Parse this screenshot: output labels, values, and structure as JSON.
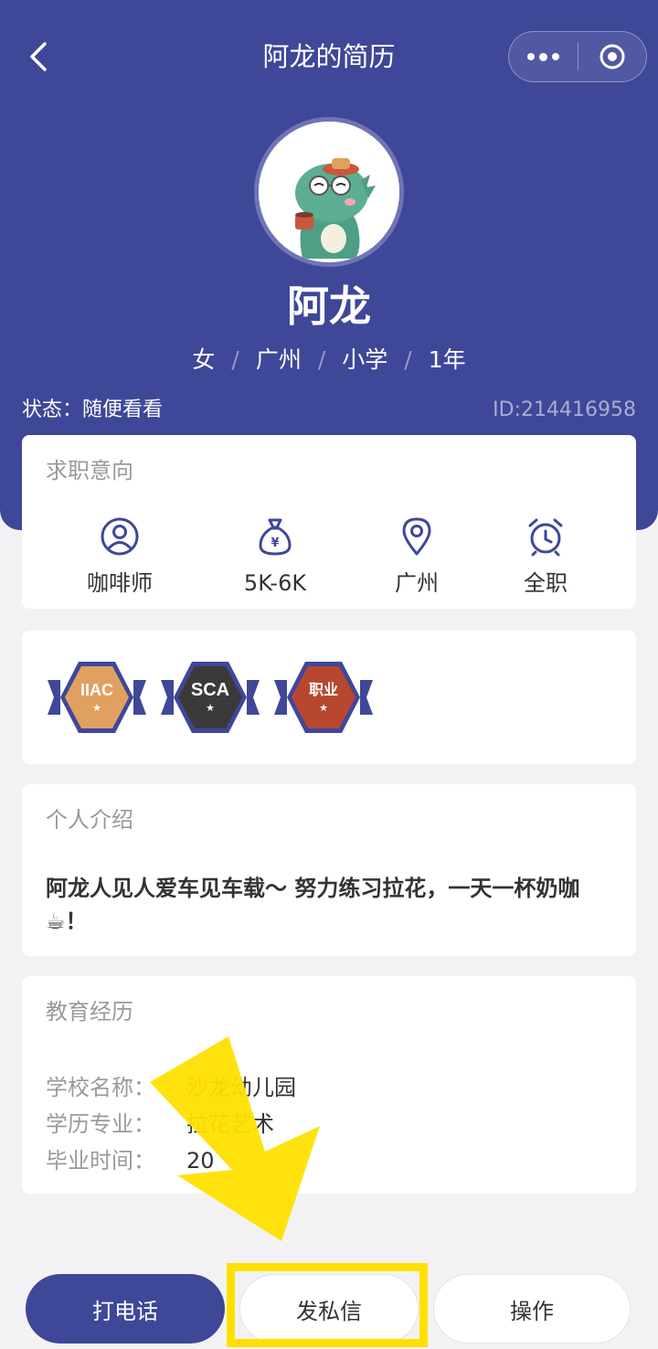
{
  "nav": {
    "title": "阿龙的简历",
    "back_icon": "chevron-left-icon",
    "more_icon": "more-dots-icon",
    "close_icon": "target-circle-icon"
  },
  "profile": {
    "name": "阿龙",
    "gender": "女",
    "city": "广州",
    "education": "小学",
    "experience": "1年",
    "status": "状态：随便看看",
    "id": "ID:214416958"
  },
  "intent": {
    "title": "求职意向",
    "items": [
      {
        "icon": "user-icon",
        "label": "咖啡师"
      },
      {
        "icon": "money-bag-icon",
        "label": "5K-6K"
      },
      {
        "icon": "location-pin-icon",
        "label": "广州"
      },
      {
        "icon": "alarm-clock-icon",
        "label": "全职"
      }
    ]
  },
  "badges": [
    {
      "text": "IIAC",
      "color": "#e0a060"
    },
    {
      "text": "SCA",
      "color": "#3a3a3a"
    },
    {
      "text": "职业",
      "color": "#b8472f"
    }
  ],
  "intro": {
    "title": "个人介绍",
    "text": "阿龙人见人爱车见车载～ 努力练习拉花，一天一杯奶咖☕！"
  },
  "education": {
    "title": "教育经历",
    "rows": [
      {
        "key": "学校名称：",
        "value": "沙龙幼儿园"
      },
      {
        "key": "学历专业：",
        "value": "拉花艺术"
      },
      {
        "key": "毕业时间：",
        "value": "20"
      }
    ]
  },
  "actions": {
    "call": "打电话",
    "message": "发私信",
    "operate": "操作"
  },
  "colors": {
    "primary": "#3f4799",
    "highlight": "#ffe000"
  }
}
